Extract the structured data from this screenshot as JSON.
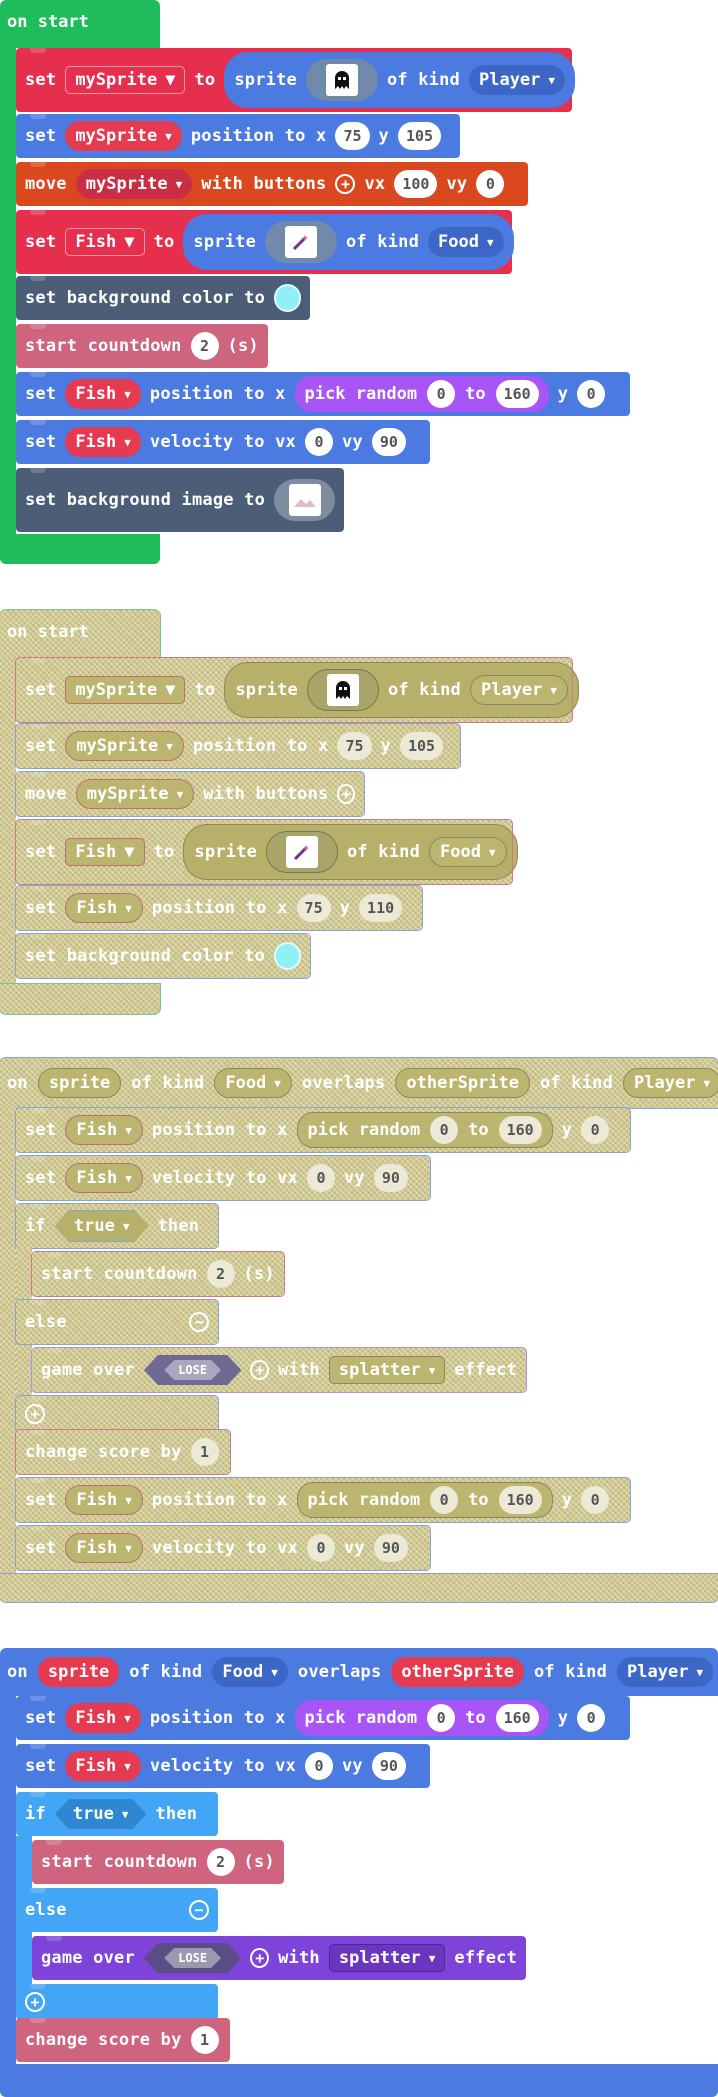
{
  "kw": {
    "on_start": "on start",
    "set": "set",
    "to": "to",
    "sprite": "sprite",
    "of_kind": "of kind",
    "position_to_x": "position to x",
    "y": "y",
    "move": "move",
    "with_buttons": "with buttons",
    "vx": "vx",
    "vy": "vy",
    "set_background_color_to": "set background color to",
    "start_countdown": "start countdown",
    "seconds": "(s)",
    "pick_random": "pick random",
    "velocity_to_vx": "velocity to vx",
    "set_background_image_to": "set background image to",
    "on": "on",
    "overlaps": "overlaps",
    "if": "if",
    "then": "then",
    "else": "else",
    "game_over": "game over",
    "with": "with",
    "effect": "effect",
    "change_score_by": "change score by",
    "true": "true",
    "lose": "LOSE",
    "splatter": "splatter"
  },
  "vars": {
    "mySprite": "mySprite",
    "Fish": "Fish",
    "sprite": "sprite",
    "otherSprite": "otherSprite"
  },
  "kinds": {
    "Player": "Player",
    "Food": "Food"
  },
  "nums": {
    "x75": "75",
    "y105": "105",
    "y110": "110",
    "vx100": "100",
    "zero": "0",
    "n160": "160",
    "vy90": "90",
    "cd2": "2",
    "score1": "1"
  },
  "icons": {
    "player_sprite": "ghost-sprite-icon",
    "food_sprite": "wand-sprite-icon",
    "background_image": "landscape-image-icon",
    "dropdown": "chevron-down-icon",
    "add": "plus-icon",
    "remove": "minus-icon"
  },
  "colors": {
    "events": "#1ebc5a",
    "sprites": "#e62e4d",
    "sprites_blue": "#4b7ae0",
    "controller": "#d9481e",
    "scene": "#4c5e77",
    "info": "#cf647f",
    "math": "#a855f7",
    "logic": "#42a5f5",
    "game": "#7e43d9",
    "background_color": "#8ff0f7"
  },
  "states": {
    "group2": "disabled",
    "group3": "disabled"
  }
}
